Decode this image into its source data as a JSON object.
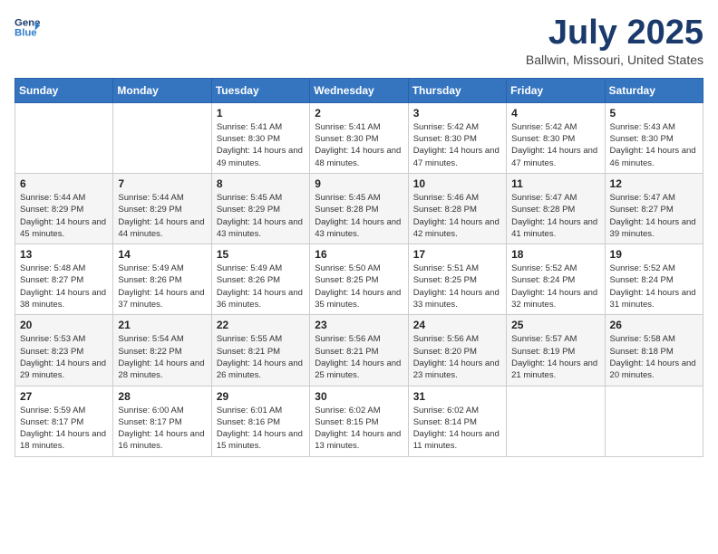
{
  "header": {
    "logo_text_general": "General",
    "logo_text_blue": "Blue",
    "month_title": "July 2025",
    "location": "Ballwin, Missouri, United States"
  },
  "weekdays": [
    "Sunday",
    "Monday",
    "Tuesday",
    "Wednesday",
    "Thursday",
    "Friday",
    "Saturday"
  ],
  "weeks": [
    [
      {
        "day": "",
        "sunrise": "",
        "sunset": "",
        "daylight": ""
      },
      {
        "day": "",
        "sunrise": "",
        "sunset": "",
        "daylight": ""
      },
      {
        "day": "1",
        "sunrise": "Sunrise: 5:41 AM",
        "sunset": "Sunset: 8:30 PM",
        "daylight": "Daylight: 14 hours and 49 minutes."
      },
      {
        "day": "2",
        "sunrise": "Sunrise: 5:41 AM",
        "sunset": "Sunset: 8:30 PM",
        "daylight": "Daylight: 14 hours and 48 minutes."
      },
      {
        "day": "3",
        "sunrise": "Sunrise: 5:42 AM",
        "sunset": "Sunset: 8:30 PM",
        "daylight": "Daylight: 14 hours and 47 minutes."
      },
      {
        "day": "4",
        "sunrise": "Sunrise: 5:42 AM",
        "sunset": "Sunset: 8:30 PM",
        "daylight": "Daylight: 14 hours and 47 minutes."
      },
      {
        "day": "5",
        "sunrise": "Sunrise: 5:43 AM",
        "sunset": "Sunset: 8:30 PM",
        "daylight": "Daylight: 14 hours and 46 minutes."
      }
    ],
    [
      {
        "day": "6",
        "sunrise": "Sunrise: 5:44 AM",
        "sunset": "Sunset: 8:29 PM",
        "daylight": "Daylight: 14 hours and 45 minutes."
      },
      {
        "day": "7",
        "sunrise": "Sunrise: 5:44 AM",
        "sunset": "Sunset: 8:29 PM",
        "daylight": "Daylight: 14 hours and 44 minutes."
      },
      {
        "day": "8",
        "sunrise": "Sunrise: 5:45 AM",
        "sunset": "Sunset: 8:29 PM",
        "daylight": "Daylight: 14 hours and 43 minutes."
      },
      {
        "day": "9",
        "sunrise": "Sunrise: 5:45 AM",
        "sunset": "Sunset: 8:28 PM",
        "daylight": "Daylight: 14 hours and 43 minutes."
      },
      {
        "day": "10",
        "sunrise": "Sunrise: 5:46 AM",
        "sunset": "Sunset: 8:28 PM",
        "daylight": "Daylight: 14 hours and 42 minutes."
      },
      {
        "day": "11",
        "sunrise": "Sunrise: 5:47 AM",
        "sunset": "Sunset: 8:28 PM",
        "daylight": "Daylight: 14 hours and 41 minutes."
      },
      {
        "day": "12",
        "sunrise": "Sunrise: 5:47 AM",
        "sunset": "Sunset: 8:27 PM",
        "daylight": "Daylight: 14 hours and 39 minutes."
      }
    ],
    [
      {
        "day": "13",
        "sunrise": "Sunrise: 5:48 AM",
        "sunset": "Sunset: 8:27 PM",
        "daylight": "Daylight: 14 hours and 38 minutes."
      },
      {
        "day": "14",
        "sunrise": "Sunrise: 5:49 AM",
        "sunset": "Sunset: 8:26 PM",
        "daylight": "Daylight: 14 hours and 37 minutes."
      },
      {
        "day": "15",
        "sunrise": "Sunrise: 5:49 AM",
        "sunset": "Sunset: 8:26 PM",
        "daylight": "Daylight: 14 hours and 36 minutes."
      },
      {
        "day": "16",
        "sunrise": "Sunrise: 5:50 AM",
        "sunset": "Sunset: 8:25 PM",
        "daylight": "Daylight: 14 hours and 35 minutes."
      },
      {
        "day": "17",
        "sunrise": "Sunrise: 5:51 AM",
        "sunset": "Sunset: 8:25 PM",
        "daylight": "Daylight: 14 hours and 33 minutes."
      },
      {
        "day": "18",
        "sunrise": "Sunrise: 5:52 AM",
        "sunset": "Sunset: 8:24 PM",
        "daylight": "Daylight: 14 hours and 32 minutes."
      },
      {
        "day": "19",
        "sunrise": "Sunrise: 5:52 AM",
        "sunset": "Sunset: 8:24 PM",
        "daylight": "Daylight: 14 hours and 31 minutes."
      }
    ],
    [
      {
        "day": "20",
        "sunrise": "Sunrise: 5:53 AM",
        "sunset": "Sunset: 8:23 PM",
        "daylight": "Daylight: 14 hours and 29 minutes."
      },
      {
        "day": "21",
        "sunrise": "Sunrise: 5:54 AM",
        "sunset": "Sunset: 8:22 PM",
        "daylight": "Daylight: 14 hours and 28 minutes."
      },
      {
        "day": "22",
        "sunrise": "Sunrise: 5:55 AM",
        "sunset": "Sunset: 8:21 PM",
        "daylight": "Daylight: 14 hours and 26 minutes."
      },
      {
        "day": "23",
        "sunrise": "Sunrise: 5:56 AM",
        "sunset": "Sunset: 8:21 PM",
        "daylight": "Daylight: 14 hours and 25 minutes."
      },
      {
        "day": "24",
        "sunrise": "Sunrise: 5:56 AM",
        "sunset": "Sunset: 8:20 PM",
        "daylight": "Daylight: 14 hours and 23 minutes."
      },
      {
        "day": "25",
        "sunrise": "Sunrise: 5:57 AM",
        "sunset": "Sunset: 8:19 PM",
        "daylight": "Daylight: 14 hours and 21 minutes."
      },
      {
        "day": "26",
        "sunrise": "Sunrise: 5:58 AM",
        "sunset": "Sunset: 8:18 PM",
        "daylight": "Daylight: 14 hours and 20 minutes."
      }
    ],
    [
      {
        "day": "27",
        "sunrise": "Sunrise: 5:59 AM",
        "sunset": "Sunset: 8:17 PM",
        "daylight": "Daylight: 14 hours and 18 minutes."
      },
      {
        "day": "28",
        "sunrise": "Sunrise: 6:00 AM",
        "sunset": "Sunset: 8:17 PM",
        "daylight": "Daylight: 14 hours and 16 minutes."
      },
      {
        "day": "29",
        "sunrise": "Sunrise: 6:01 AM",
        "sunset": "Sunset: 8:16 PM",
        "daylight": "Daylight: 14 hours and 15 minutes."
      },
      {
        "day": "30",
        "sunrise": "Sunrise: 6:02 AM",
        "sunset": "Sunset: 8:15 PM",
        "daylight": "Daylight: 14 hours and 13 minutes."
      },
      {
        "day": "31",
        "sunrise": "Sunrise: 6:02 AM",
        "sunset": "Sunset: 8:14 PM",
        "daylight": "Daylight: 14 hours and 11 minutes."
      },
      {
        "day": "",
        "sunrise": "",
        "sunset": "",
        "daylight": ""
      },
      {
        "day": "",
        "sunrise": "",
        "sunset": "",
        "daylight": ""
      }
    ]
  ]
}
